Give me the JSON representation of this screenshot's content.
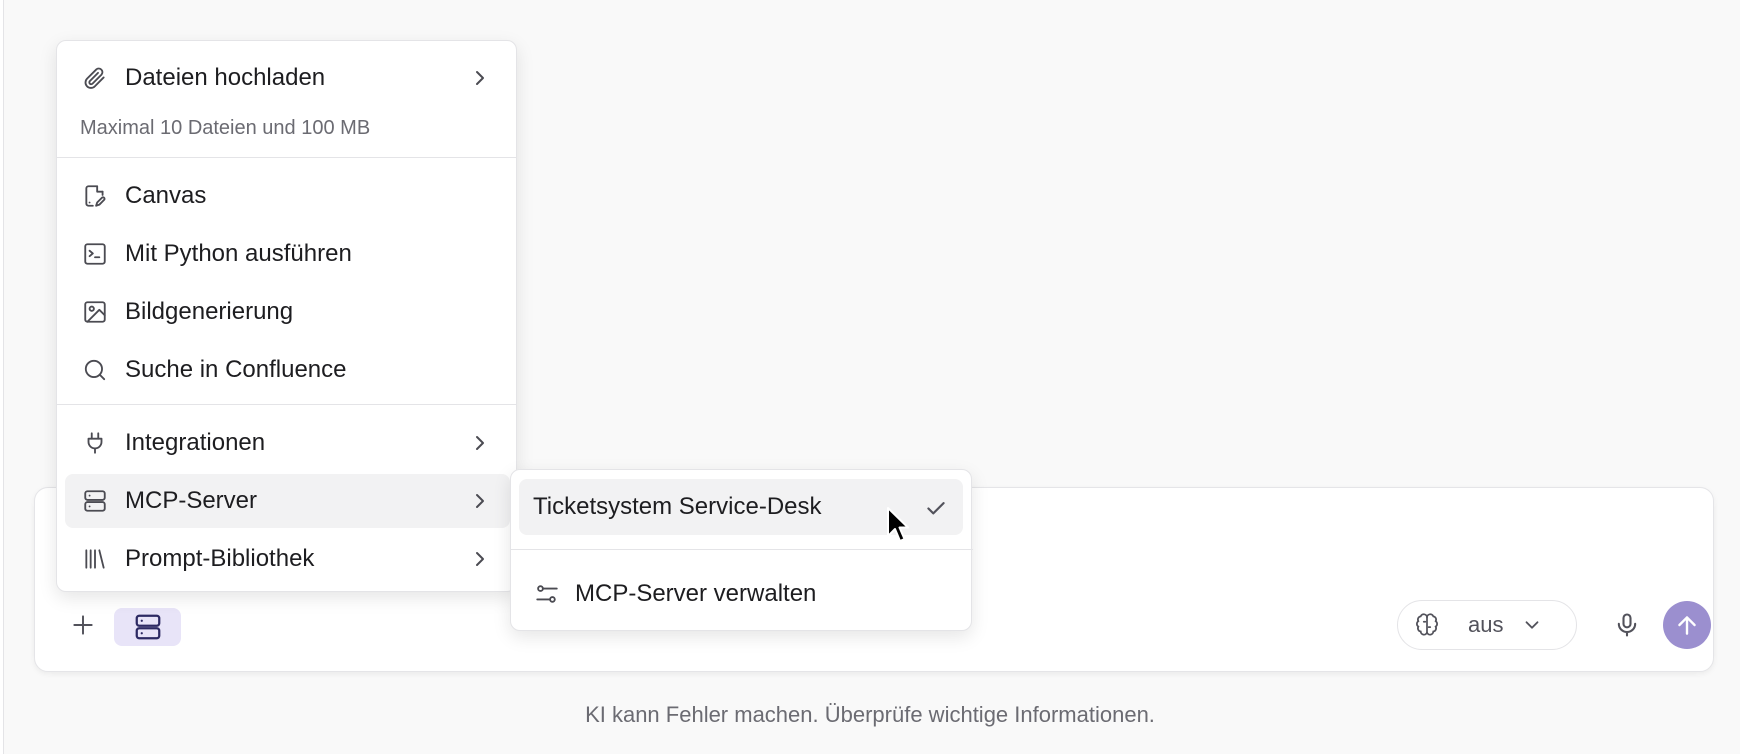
{
  "menu": {
    "upload": {
      "label": "Dateien hochladen",
      "icon": "paperclip-icon",
      "hint": "Maximal 10 Dateien und 100 MB"
    },
    "tools": [
      {
        "label": "Canvas",
        "icon": "canvas-icon"
      },
      {
        "label": "Mit Python ausführen",
        "icon": "terminal-icon"
      },
      {
        "label": "Bildgenerierung",
        "icon": "image-icon"
      },
      {
        "label": "Suche in Confluence",
        "icon": "search-icon"
      }
    ],
    "integrations": {
      "label": "Integrationen",
      "icon": "plug-icon"
    },
    "mcp_server": {
      "label": "MCP-Server",
      "icon": "server-icon"
    },
    "prompt_library": {
      "label": "Prompt-Bibliothek",
      "icon": "library-icon"
    }
  },
  "submenu": {
    "servers": [
      {
        "label": "Ticketsystem Service-Desk",
        "selected": true
      }
    ],
    "manage": {
      "label": "MCP-Server verwalten",
      "icon": "sliders-icon"
    }
  },
  "composer": {
    "reasoning": {
      "value": "aus",
      "icon": "brain-icon"
    }
  },
  "disclaimer": "KI kann Fehler machen. Überprüfe wichtige Informationen.",
  "colors": {
    "accent": "#9b8fcf",
    "accent_light": "#e8e4f8",
    "background": "#f9f9f9"
  }
}
